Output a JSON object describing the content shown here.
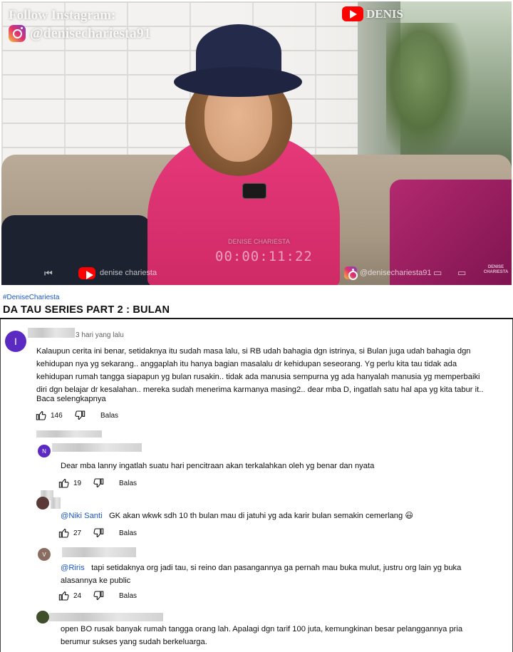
{
  "video": {
    "overlay_follow": "Follow Instagram:",
    "overlay_ig_handle": "@denisechariesta91",
    "overlay_channel_top": "DENIS",
    "watermark_center": "DENISE CHARIESTA",
    "timecode": "00:00:11:22",
    "bottom_channel": "denise chariesta",
    "bottom_ig": "@denisechariesta91",
    "bottom_right_brand": "DENISE CHARIESTA"
  },
  "hashtag": "#DeniseChariesta",
  "title": "DA TAU SERIES PART 2 : BULAN",
  "colors": {
    "mention": "#1a57c2",
    "avatar_purple": "#5b2ac3",
    "avatar_brown": "#8a6d60",
    "avatar_green": "#3f4f2c"
  },
  "comments": [
    {
      "avatar_letter": "I",
      "time": "3 hari yang lalu",
      "text_lines": [
        "Kalaupun cerita ini benar, setidaknya itu sudah masa lalu, si RB udah bahagia dgn istrinya, si Bulan juga udah bahagia dgn",
        "kehidupan nya yg sekarang.. anggaplah itu hanya bagian masalalu dr kehidupan seseorang. Yg perlu kita tau tidak ada",
        "kehidupan rumah tangga siapapun yg bulan rusakin..  tidak ada manusia sempurna yg ada hanyalah manusia yg memperbaiki",
        "diri dgn belajar dr kesalahan.. mereka sudah menerima karmanya masing2.. dear mba D, ingatlah satu hal apa yg kita tabur it.."
      ],
      "read_more": "Baca selengkapnya",
      "likes": "146",
      "reply": "Balas"
    },
    {
      "avatar_letter": "N",
      "text_lines": [
        "Dear mba lanny ingatlah suatu hari pencitraan akan terkalahkan oleh yg benar dan nyata"
      ],
      "likes": "19",
      "reply": "Balas"
    },
    {
      "mention": "@Niki Santi",
      "text_lines": [
        "GK akan wkwk sdh 10 th bulan mau di jatuhi yg ada karir bulan semakin cemerlang 😃"
      ],
      "likes": "27",
      "reply": "Balas"
    },
    {
      "avatar_letter": "V",
      "mention": "@Riris",
      "text_lines": [
        "tapi setidaknya org jadi tau, si reino dan pasangannya ga pernah mau buka mulut, justru org  lain yg buka",
        "alasannya ke public"
      ],
      "likes": "24",
      "reply": "Balas"
    },
    {
      "text_lines": [
        "open BO rusak banyak rumah tangga orang lah. Apalagi dgn tarif 100 juta, kemungkinan besar pelanggannya pria",
        "berumur sukses yang sudah berkeluarga."
      ]
    }
  ]
}
